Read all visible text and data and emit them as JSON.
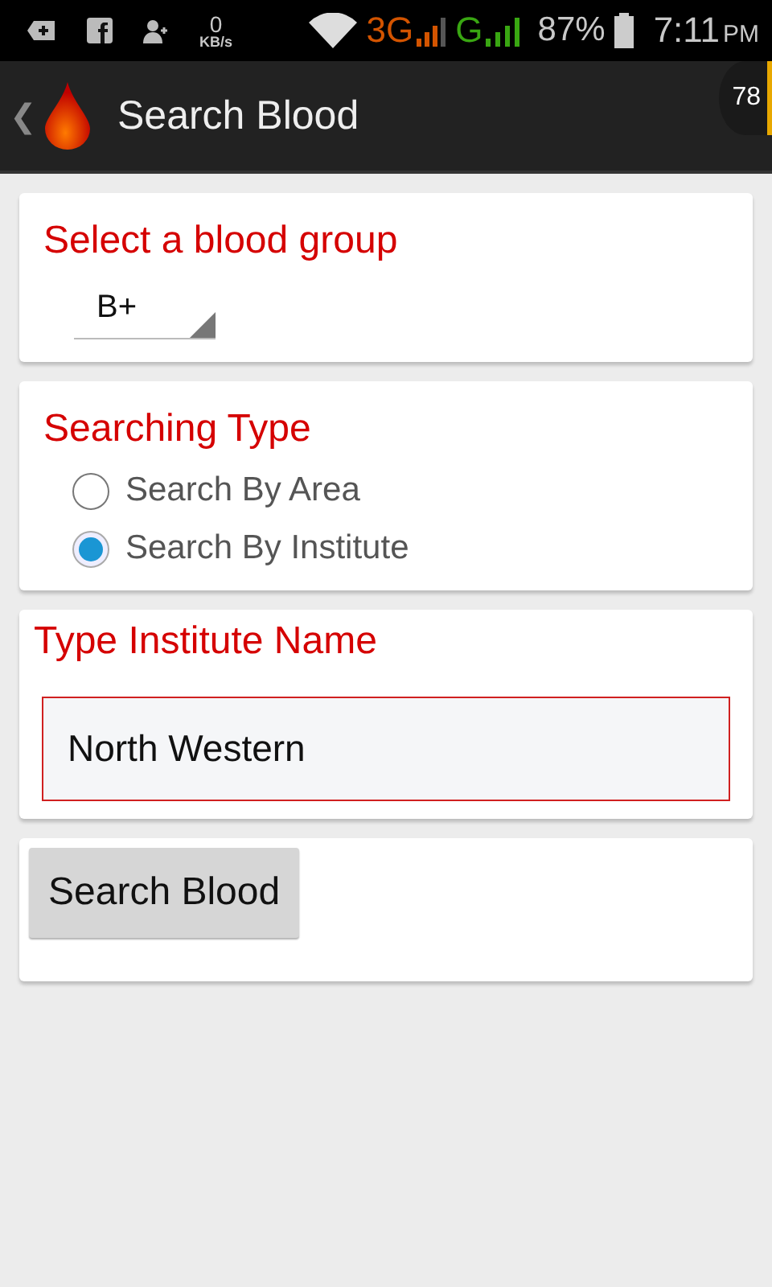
{
  "status_bar": {
    "data_rate": "0",
    "data_unit": "KB/s",
    "network_1": "3G",
    "network_2": "G",
    "battery": "87%",
    "time": "7:11",
    "ampm": "PM"
  },
  "action_bar": {
    "back": "❮",
    "title": "Search Blood",
    "badge": "78"
  },
  "blood_group": {
    "label": "Select a blood group",
    "value": "B+"
  },
  "searching_type": {
    "label": "Searching Type",
    "options": [
      {
        "label": "Search By Area",
        "selected": false
      },
      {
        "label": "Search By Institute",
        "selected": true
      }
    ]
  },
  "institute": {
    "label": "Type Institute Name",
    "value": "North Western"
  },
  "button": "Search Blood"
}
